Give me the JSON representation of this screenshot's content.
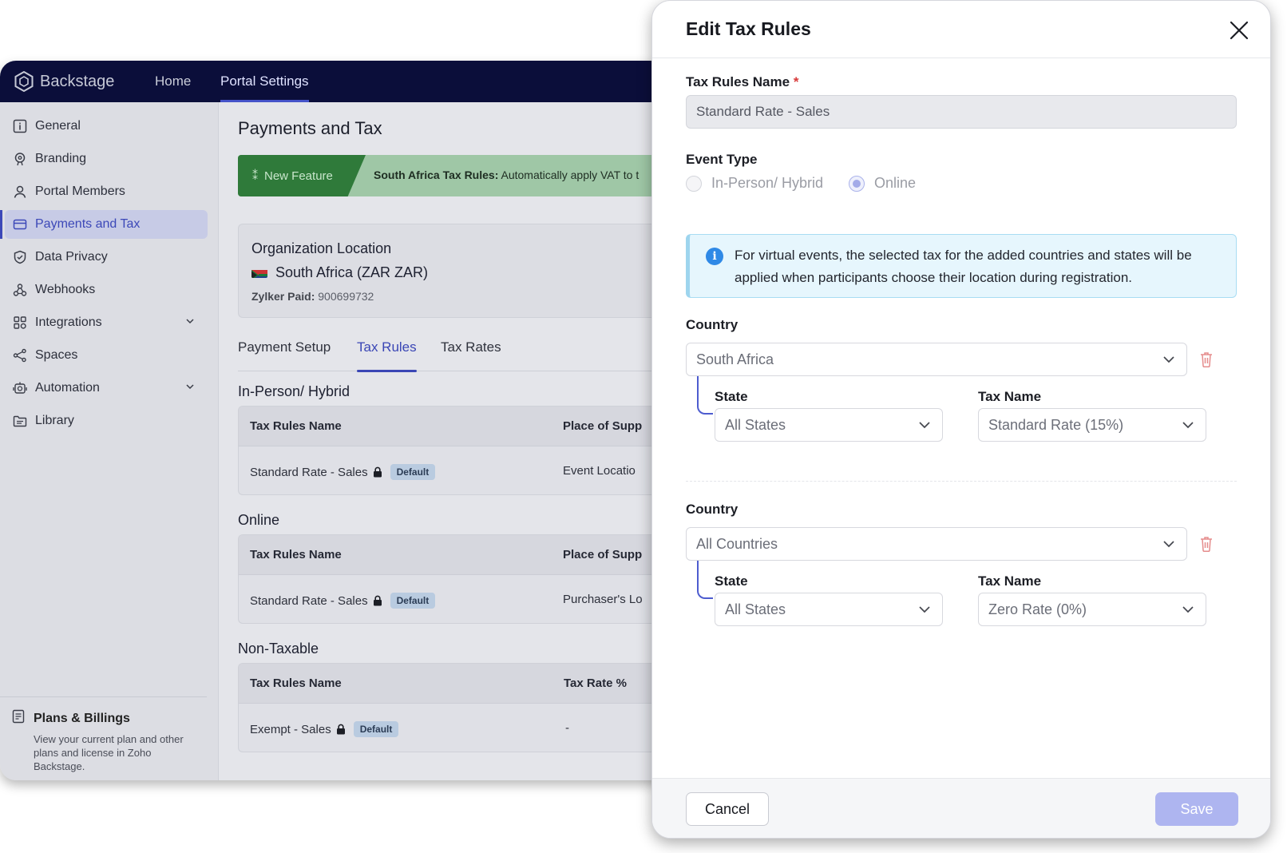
{
  "app": {
    "brand": "Backstage",
    "nav": [
      "Home",
      "Portal Settings"
    ],
    "sidebar": {
      "items": [
        {
          "label": "General",
          "icon": "info-square-icon"
        },
        {
          "label": "Branding",
          "icon": "palette-icon"
        },
        {
          "label": "Portal Members",
          "icon": "user-icon"
        },
        {
          "label": "Payments and Tax",
          "icon": "card-icon",
          "active": true
        },
        {
          "label": "Data Privacy",
          "icon": "shield-icon"
        },
        {
          "label": "Webhooks",
          "icon": "webhook-icon"
        },
        {
          "label": "Integrations",
          "icon": "grid-icon",
          "expandable": true
        },
        {
          "label": "Spaces",
          "icon": "share-nodes-icon"
        },
        {
          "label": "Automation",
          "icon": "robot-icon",
          "expandable": true
        },
        {
          "label": "Library",
          "icon": "folder-icon"
        }
      ],
      "plans": {
        "title": "Plans & Billings",
        "description": "View your current plan and other plans and license in Zoho Backstage."
      }
    },
    "main": {
      "title": "Payments and Tax",
      "banner": {
        "tag": "New Feature",
        "bold": "South Africa Tax Rules:",
        "text": " Automatically apply VAT to t"
      },
      "org": {
        "label": "Organization Location",
        "country": "South Africa (ZAR  ZAR)",
        "paid_label": "Zylker Paid:",
        "paid_value": " 900699732"
      },
      "tabs": [
        "Payment Setup",
        "Tax Rules",
        "Tax Rates"
      ],
      "active_tab": "Tax Rules",
      "sections": [
        {
          "title": "In-Person/ Hybrid",
          "headers": [
            "Tax Rules Name",
            "Place of Supp"
          ],
          "row": {
            "name": "Standard Rate - Sales",
            "badge": "Default",
            "place": "Event Locatio"
          }
        },
        {
          "title": "Online",
          "headers": [
            "Tax Rules Name",
            "Place of Supp"
          ],
          "row": {
            "name": "Standard Rate - Sales",
            "badge": "Default",
            "place": "Purchaser's Lo"
          }
        },
        {
          "title": "Non-Taxable",
          "headers": [
            "Tax Rules Name",
            "Tax Rate %"
          ],
          "row": {
            "name": "Exempt - Sales",
            "badge": "Default",
            "place": "-"
          }
        }
      ]
    }
  },
  "modal": {
    "title": "Edit Tax Rules",
    "name_label": "Tax Rules Name",
    "required_mark": "*",
    "name_value": "Standard Rate - Sales",
    "event_type_label": "Event Type",
    "event_options": [
      "In-Person/ Hybrid",
      "Online"
    ],
    "event_selected": "Online",
    "info_text": "For virtual events, the selected tax for the added countries and states will be applied when participants choose their location during registration.",
    "rules": [
      {
        "country_label": "Country",
        "country": "South Africa",
        "state_label": "State",
        "state": "All States",
        "tax_label": "Tax Name",
        "tax": "Standard Rate (15%)"
      },
      {
        "country_label": "Country",
        "country": "All Countries",
        "state_label": "State",
        "state": "All States",
        "tax_label": "Tax Name",
        "tax": "Zero Rate (0%)"
      }
    ],
    "cancel": "Cancel",
    "save": "Save"
  },
  "colors": {
    "brand_navy": "#0b0e3a",
    "accent": "#3a46b5",
    "save_disabled": "#aeb5f0",
    "info_bg": "#e6f6fd",
    "delete_red": "#e58c8c"
  }
}
